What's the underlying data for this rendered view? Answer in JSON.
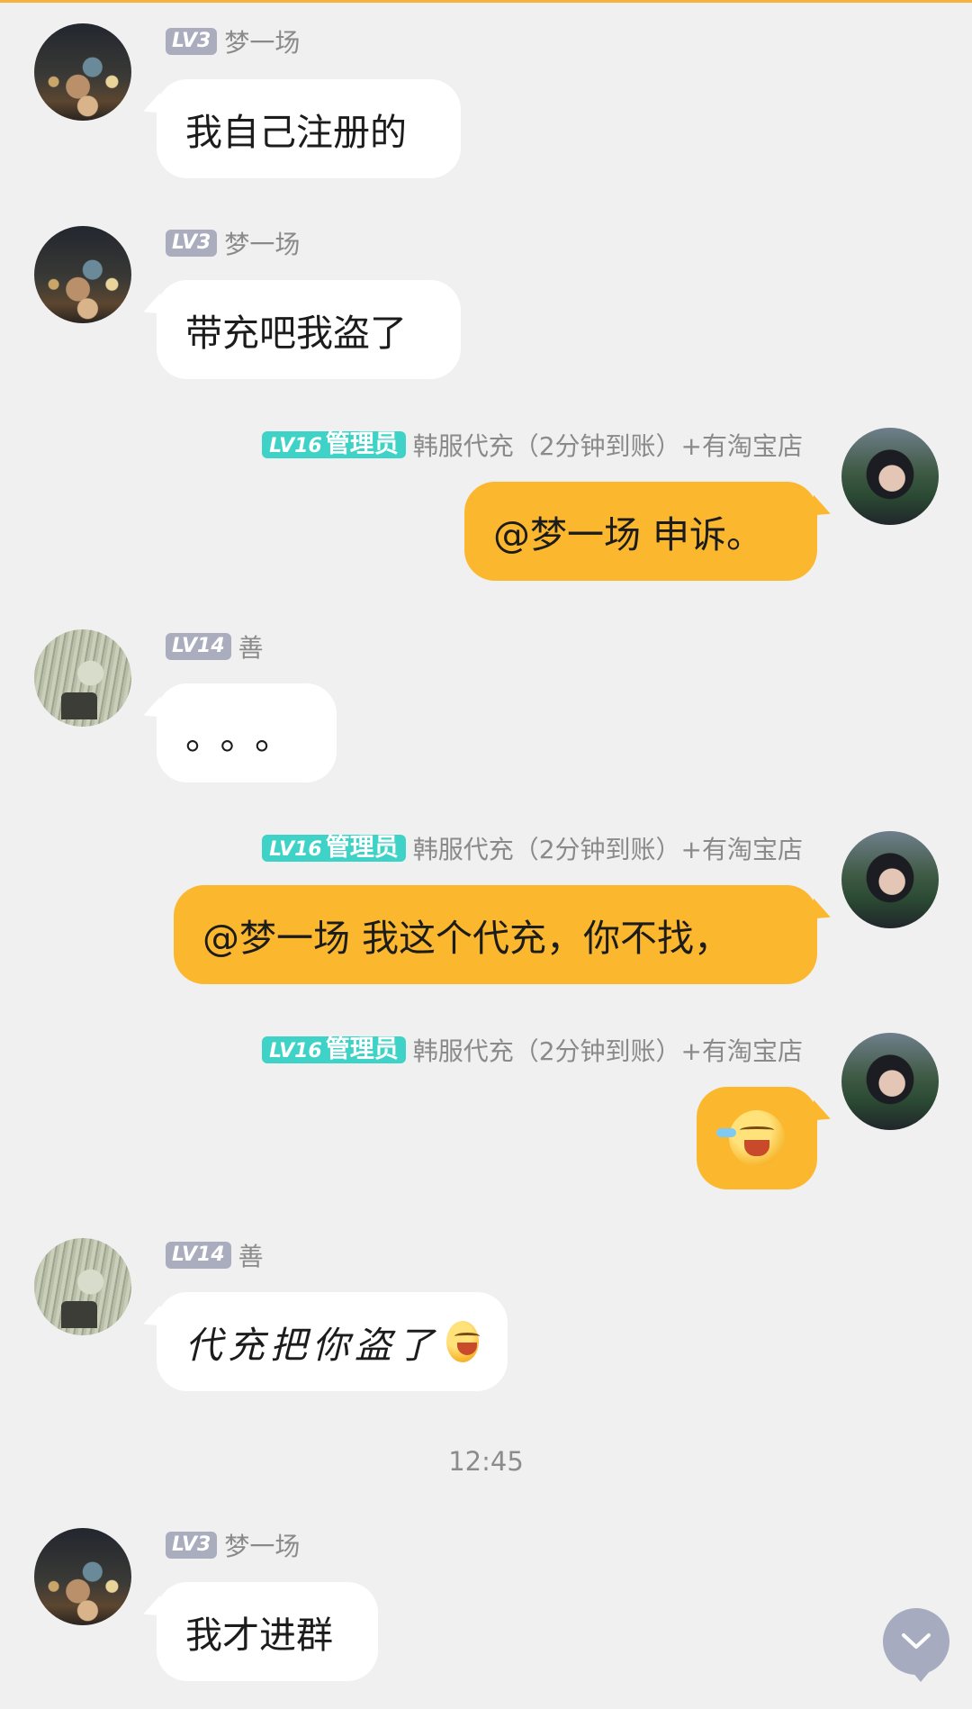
{
  "messages": [
    {
      "side": "in",
      "level": "LV3",
      "nickname": "梦一场",
      "text": "我自己注册的"
    },
    {
      "side": "in",
      "level": "LV3",
      "nickname": "梦一场",
      "text": "带充吧我盗了"
    },
    {
      "side": "out",
      "level": "LV16",
      "role": "管理员",
      "nickname": "韩服代充（2分钟到账）+有淘宝店",
      "text": "@梦一场 申诉。"
    },
    {
      "side": "in",
      "level": "LV14",
      "nickname": "善",
      "text": "。。。"
    },
    {
      "side": "out",
      "level": "LV16",
      "role": "管理员",
      "nickname": "韩服代充（2分钟到账）+有淘宝店",
      "text": "@梦一场 我这个代充，你不找，"
    },
    {
      "side": "out",
      "level": "LV16",
      "role": "管理员",
      "nickname": "韩服代充（2分钟到账）+有淘宝店",
      "emoji": "crying-laughing-emoji"
    },
    {
      "side": "in",
      "level": "LV14",
      "nickname": "善",
      "text": "代充把你盗了",
      "emoji": "laughing-emoji"
    },
    {
      "side": "in",
      "level": "LV3",
      "nickname": "梦一场",
      "text": "我才进群"
    }
  ],
  "timestamp": "12:45",
  "colors": {
    "background": "#f0f0f0",
    "incoming_bubble": "#ffffff",
    "outgoing_bubble": "#fbb82f",
    "level_badge": "#a9adbd",
    "admin_badge": "#3fd3c8",
    "top_accent": "#f6b23a"
  },
  "scroll_button": {
    "icon": "chevron-down-icon"
  }
}
